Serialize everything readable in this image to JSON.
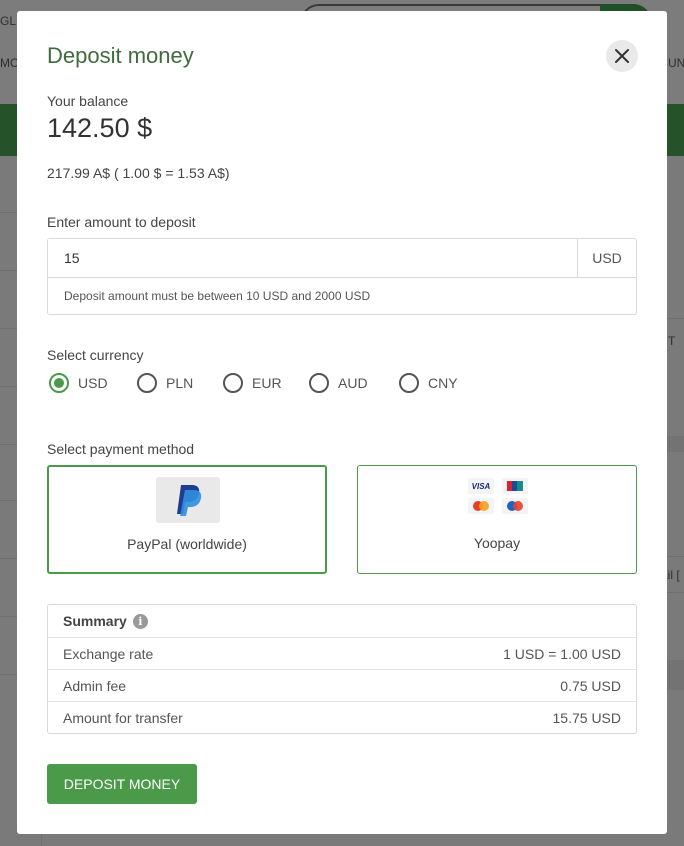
{
  "background": {
    "top_left_text_1": "GLI",
    "top_left_text_2": "MO",
    "top_right_text": "UN",
    "right_text_1": "ail [",
    "right_icon_text": "T"
  },
  "modal": {
    "title": "Deposit money",
    "close_icon": "close-icon",
    "balance": {
      "label": "Your balance",
      "value": "142.50 $",
      "converted": "217.99 A$ ( 1.00 $ = 1.53 A$)"
    },
    "amount": {
      "label": "Enter amount to deposit",
      "value": "15",
      "unit": "USD",
      "hint": "Deposit amount must be between 10 USD and 2000 USD"
    },
    "currency": {
      "label": "Select currency",
      "options": [
        {
          "label": "USD",
          "selected": true
        },
        {
          "label": "PLN",
          "selected": false
        },
        {
          "label": "EUR",
          "selected": false
        },
        {
          "label": "AUD",
          "selected": false
        },
        {
          "label": "CNY",
          "selected": false
        }
      ]
    },
    "payment": {
      "label": "Select payment method",
      "methods": [
        {
          "name": "PayPal (worldwide)",
          "icon": "paypal-icon",
          "selected": true
        },
        {
          "name": "Yoopay",
          "icon": "card-logos-icon",
          "selected": false
        }
      ],
      "card_logo_text": "VISA"
    },
    "summary": {
      "title": "Summary",
      "info_icon": "i",
      "rows": [
        {
          "label": "Exchange rate",
          "value": "1 USD = 1.00 USD"
        },
        {
          "label": "Admin fee",
          "value": "0.75 USD"
        },
        {
          "label": "Amount for transfer",
          "value": "15.75 USD"
        }
      ]
    },
    "submit_label": "DEPOSIT MONEY"
  },
  "colors": {
    "accent": "#4a9a4a",
    "title": "#3f6b3f",
    "overlay": "#7a7a7a"
  }
}
